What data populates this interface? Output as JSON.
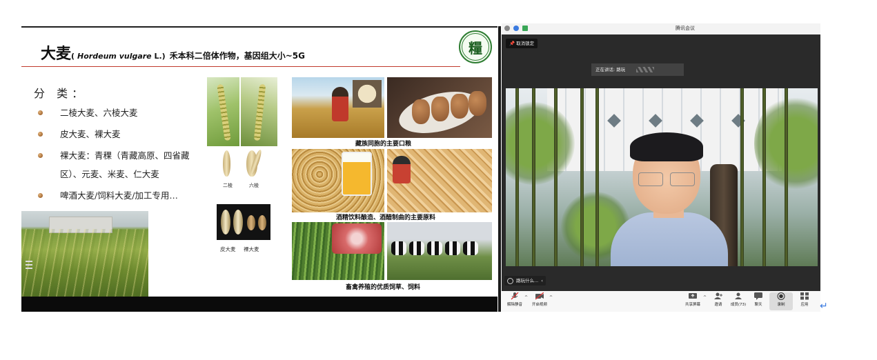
{
  "slide": {
    "title_main": "大麦",
    "title_latin_open": "(",
    "title_latin": "Hordeum vulgare",
    "title_latin_tail": " L.)",
    "title_rest": "禾本科二倍体作物，基因组大小~5G",
    "logo_char": "糧",
    "classification_header": "分 类：",
    "bullets": [
      "二棱大麦、六棱大麦",
      "皮大麦、裸大麦",
      "裸大麦：青稞（青藏高原、四省藏",
      "区）、元麦、米麦、仁大麦",
      "啤酒大麦/饲料大麦/加工专用…"
    ],
    "seed_labels": [
      "二棱",
      "六棱"
    ],
    "grain_labels": [
      "皮大麦",
      "裸大麦"
    ],
    "captions": [
      "藏族同胞的主要口粮",
      "酒精饮料酿造、酒醋制曲的主要原料",
      "畜禽养殖的优质饲草、饲料"
    ]
  },
  "meeting": {
    "window_title": "腾讯会议",
    "pin_label": "取消锁定",
    "speaking_label": "正在讲话: 路玩",
    "participant_name": "路玩什么...",
    "toolbar": {
      "mute": "解除静音",
      "video": "开启视频",
      "share": "共享屏幕",
      "invite": "邀请",
      "members": "成员(73)",
      "chat": "聊天",
      "record": "录制",
      "apps": "应用"
    }
  },
  "colors": {
    "title_red_line": "#c0392b",
    "logo_green": "#2e7d32",
    "toolbar_bg": "#f7f7f7",
    "return_arrow": "#3b7be0"
  },
  "icons": {
    "return": "↵"
  }
}
